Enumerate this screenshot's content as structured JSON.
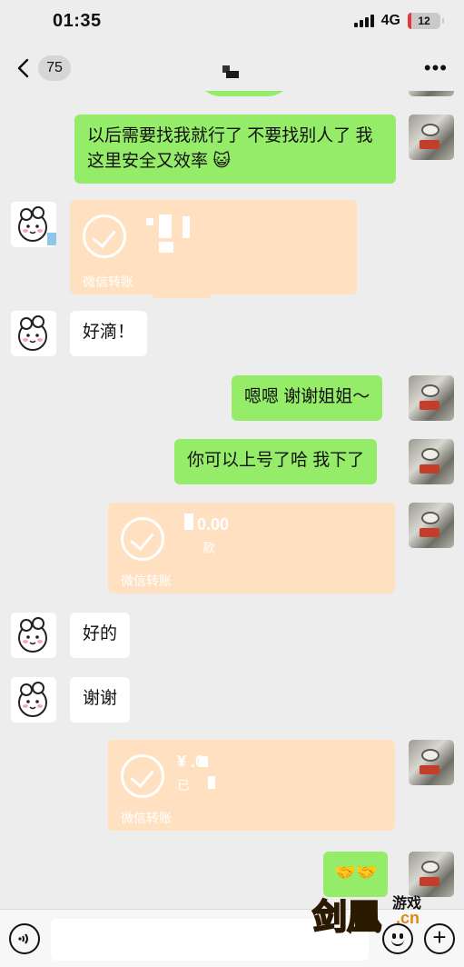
{
  "status": {
    "time": "01:35",
    "network": "4G",
    "battery": "12",
    "battery_color": "#e53935"
  },
  "header": {
    "unread_count": "75"
  },
  "messages": [
    {
      "id": "m1",
      "from": "self",
      "type": "text",
      "text": "以后需要找我就行了 不要找别人了 我这里安全又效率",
      "emoji": "cat-face-icon"
    },
    {
      "id": "m2",
      "from": "other",
      "type": "transfer",
      "footer": "微信转账"
    },
    {
      "id": "m3",
      "from": "other",
      "type": "text",
      "text": "好滴！"
    },
    {
      "id": "m4",
      "from": "self",
      "type": "text",
      "text": "嗯嗯 谢谢姐姐～"
    },
    {
      "id": "m5",
      "from": "self",
      "type": "text",
      "text": "你可以上号了哈 我下了"
    },
    {
      "id": "m6",
      "from": "self",
      "type": "transfer",
      "amount": "0.00",
      "status": "款",
      "footer": "微信转账"
    },
    {
      "id": "m7",
      "from": "other",
      "type": "text",
      "text": "好的"
    },
    {
      "id": "m8",
      "from": "other",
      "type": "text",
      "text": "谢谢"
    },
    {
      "id": "m9",
      "from": "self",
      "type": "transfer",
      "amount": "¥ .0",
      "status": "已",
      "footer": "微信转账"
    },
    {
      "id": "m10",
      "from": "self",
      "type": "text",
      "text": "🤝🤝"
    }
  ],
  "watermark": {
    "main": "剑凰",
    "sub": "游戏",
    "domain": ".cn"
  },
  "colors": {
    "self_bubble": "#95ec69",
    "other_bubble": "#ffffff",
    "transfer": "#ffe0c0",
    "background": "#ededed"
  }
}
